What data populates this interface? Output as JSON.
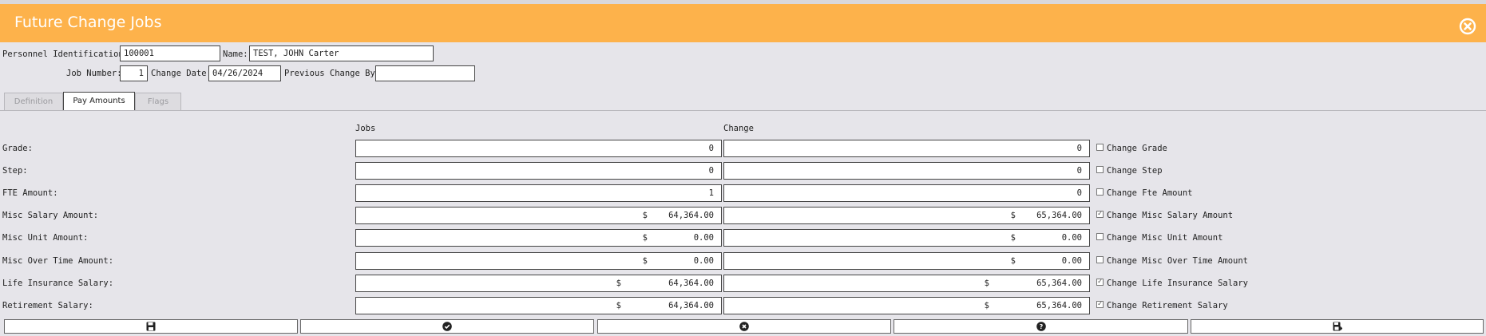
{
  "window": {
    "title": "Future Change Jobs"
  },
  "header": {
    "pid_label": "Personnel Identification:",
    "pid_value": "100001",
    "name_label": "Name:",
    "name_value": "TEST, JOHN Carter",
    "job_number_label": "Job Number:",
    "job_number_value": "1",
    "change_date_label": "Change Date:",
    "change_date_value": "04/26/2024",
    "prev_change_label": "Previous Change By:",
    "prev_change_value": ""
  },
  "tabs": [
    {
      "label": "Definition",
      "active": false
    },
    {
      "label": "Pay Amounts",
      "active": true
    },
    {
      "label": "Flags",
      "active": false
    }
  ],
  "columns": {
    "jobs": "Jobs",
    "change": "Change"
  },
  "rows": [
    {
      "label": "Grade:",
      "jobs": "0",
      "change": "0",
      "currency": false,
      "checked": false,
      "check_label": "Change Grade"
    },
    {
      "label": "Step:",
      "jobs": "0",
      "change": "0",
      "currency": false,
      "checked": false,
      "check_label": "Change Step"
    },
    {
      "label": "FTE Amount:",
      "jobs": "1",
      "change": "0",
      "currency": false,
      "checked": false,
      "check_label": "Change Fte Amount"
    },
    {
      "label": "Misc Salary Amount:",
      "jobs": "64,364.00",
      "change": "65,364.00",
      "currency": "near",
      "checked": true,
      "check_label": "Change Misc Salary Amount"
    },
    {
      "label": "Misc Unit Amount:",
      "jobs": "0.00",
      "change": "0.00",
      "currency": "near",
      "checked": false,
      "check_label": "Change Misc Unit Amount"
    },
    {
      "label": "Misc Over Time Amount:",
      "jobs": "0.00",
      "change": "0.00",
      "currency": "near",
      "checked": false,
      "check_label": "Change Misc Over Time Amount"
    },
    {
      "label": "Life Insurance Salary:",
      "jobs": "64,364.00",
      "change": "65,364.00",
      "currency": "far",
      "checked": true,
      "check_label": "Change Life Insurance Salary"
    },
    {
      "label": "Retirement Salary:",
      "jobs": "64,364.00",
      "change": "65,364.00",
      "currency": "far",
      "checked": true,
      "check_label": "Change Retirement Salary"
    }
  ],
  "currency_symbol": "$",
  "buttons": [
    {
      "icon": "save-icon"
    },
    {
      "icon": "check-circle-icon"
    },
    {
      "icon": "cancel-circle-icon"
    },
    {
      "icon": "help-circle-icon"
    },
    {
      "icon": "save-as-icon"
    }
  ]
}
